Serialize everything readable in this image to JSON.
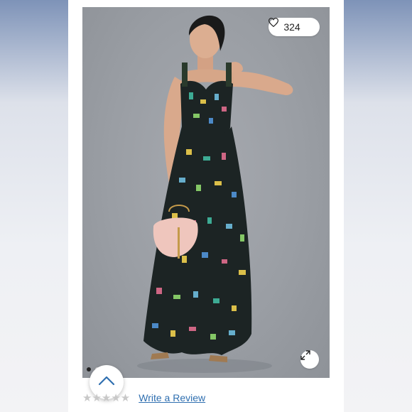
{
  "product": {
    "like_count": "324",
    "heart_icon": "heart-outline-icon",
    "expand_icon": "expand-arrows-icon"
  },
  "carousel": {
    "total_images": 2,
    "active_index": 0
  },
  "scroll_top": {
    "icon": "chevron-up-icon",
    "color": "#2f6fb0"
  },
  "reviews": {
    "rating": 0,
    "max_rating": 5,
    "stars_text": "★★★★★",
    "write_review_label": "Write a Review"
  },
  "colors": {
    "link": "#2f6fb0",
    "photo_background": "#9a9ea4",
    "dress": "#1c2424"
  }
}
